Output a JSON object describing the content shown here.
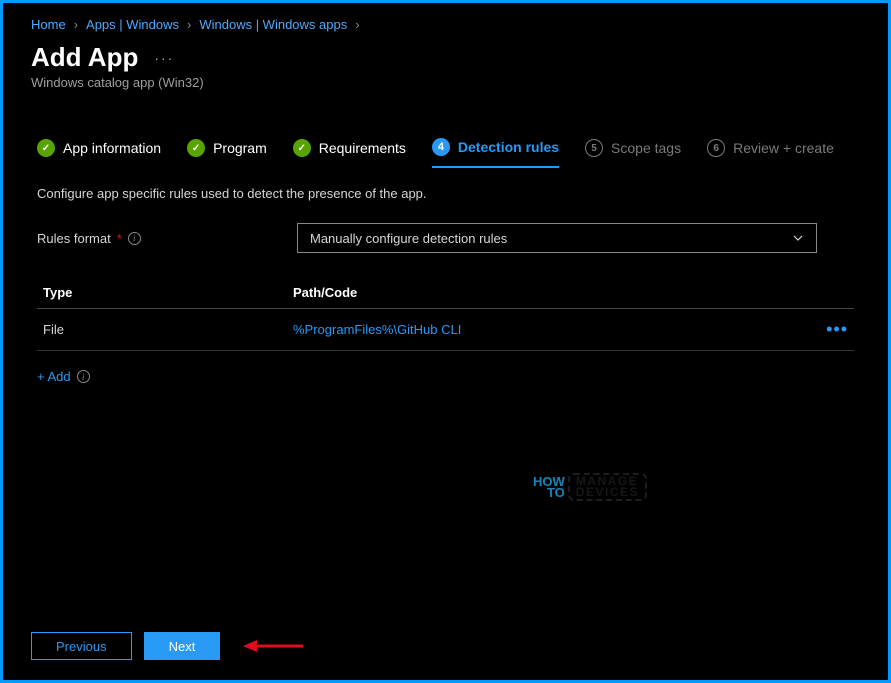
{
  "breadcrumb": {
    "items": [
      "Home",
      "Apps | Windows",
      "Windows | Windows apps"
    ]
  },
  "header": {
    "title": "Add App",
    "subtitle": "Windows catalog app (Win32)"
  },
  "wizard": {
    "steps": [
      {
        "label": "App information",
        "state": "complete",
        "badge": "✓"
      },
      {
        "label": "Program",
        "state": "complete",
        "badge": "✓"
      },
      {
        "label": "Requirements",
        "state": "complete",
        "badge": "✓"
      },
      {
        "label": "Detection rules",
        "state": "active",
        "badge": "4"
      },
      {
        "label": "Scope tags",
        "state": "pending",
        "badge": "5"
      },
      {
        "label": "Review + create",
        "state": "pending",
        "badge": "6"
      }
    ]
  },
  "description": "Configure app specific rules used to detect the presence of the app.",
  "form": {
    "rules_format_label": "Rules format",
    "rules_format_value": "Manually configure detection rules"
  },
  "table": {
    "headers": {
      "type": "Type",
      "path": "Path/Code"
    },
    "rows": [
      {
        "type": "File",
        "path": "%ProgramFiles%\\GitHub CLI"
      }
    ]
  },
  "add_link": "+ Add",
  "footer": {
    "previous": "Previous",
    "next": "Next"
  },
  "watermark": {
    "how": "HOW",
    "to": "TO",
    "manage": "MANAGE",
    "devices": "DEVICES"
  }
}
